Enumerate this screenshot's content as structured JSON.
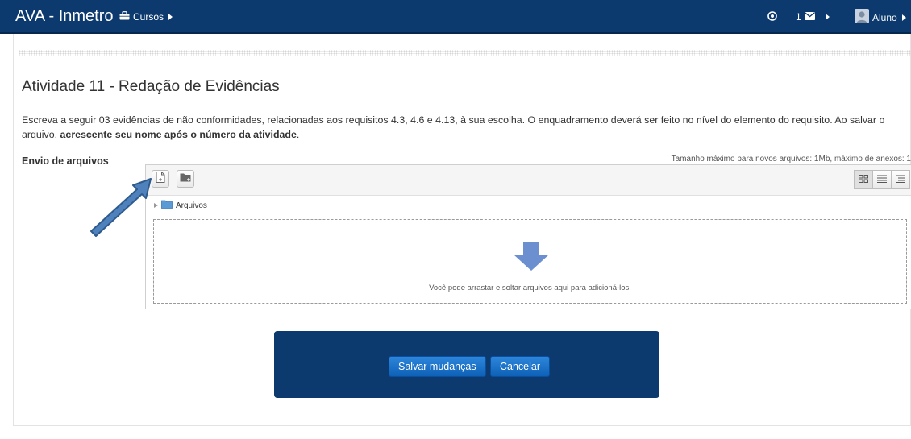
{
  "navbar": {
    "brand": "AVA - Inmetro",
    "courses_label": "Cursos",
    "message_count": "1",
    "user_label": "Aluno"
  },
  "page": {
    "title": "Atividade 11 - Redação de Evidências",
    "description_part1": "Escreva a seguir 03 evidências de não conformidades, relacionadas aos requisitos 4.3, 4.6 e 4.13, à sua escolha. O enquadramento deverá ser feito no nível do elemento do requisito. Ao salvar o arquivo, ",
    "description_bold": "acrescente seu nome após o número da atividade",
    "description_end": "."
  },
  "filepicker": {
    "label": "Envio de arquivos",
    "limit_text": "Tamanho máximo para novos arquivos: 1Mb, máximo de anexos: 1",
    "folder_label": "Arquivos",
    "drop_message": "Você pode arrastar e soltar arquivos aqui para adicioná-los."
  },
  "buttons": {
    "save": "Salvar mudanças",
    "cancel": "Cancelar"
  },
  "colors": {
    "navbar": "#0c3a6e",
    "button": "#0d61b7",
    "arrow": "#4f81bd"
  }
}
